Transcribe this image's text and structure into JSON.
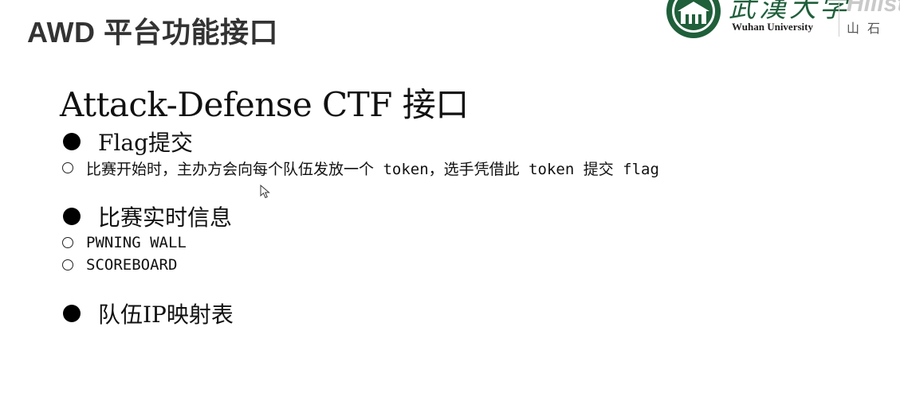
{
  "slide": {
    "title": "AWD 平台功能接口"
  },
  "logo": {
    "university_calligraphy": "武漢大学",
    "university_english": "Wuhan University",
    "lab_name": "Hillst",
    "lab_cn": "山石"
  },
  "content": {
    "heading": "Attack-Defense CTF 接口",
    "sections": [
      {
        "label": "Flag提交",
        "items": [
          "比赛开始时，主办方会向每个队伍发放一个 token，选手凭借此 token 提交 flag"
        ]
      },
      {
        "label": "比赛实时信息",
        "items": [
          "PWNING WALL",
          "SCOREBOARD"
        ]
      },
      {
        "label": "队伍IP映射表",
        "items": []
      }
    ]
  },
  "colors": {
    "title": "#333333",
    "text": "#111111",
    "university_green": "#1f5f3a",
    "lab_gray": "#c9c9c9"
  },
  "icons": {
    "bullet": "filled-circle-bullet",
    "sub_bullet": "hollow-circle-bullet",
    "cursor": "mouse-pointer-icon",
    "seal": "university-seal-icon"
  }
}
